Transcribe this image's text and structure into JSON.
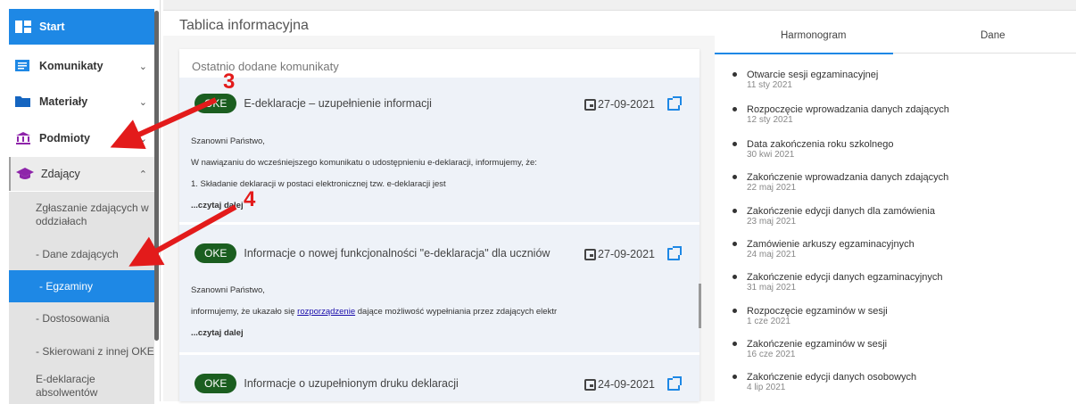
{
  "sidebar": {
    "start": "Start",
    "komunikaty": "Komunikaty",
    "materialy": "Materiały",
    "podmioty": "Podmioty",
    "zdajacy": "Zdający",
    "sub": {
      "zgl_1": "Zgłaszanie zdających w",
      "zgl_2": "oddziałach",
      "dane": "- Dane zdających",
      "egz": "- Egzaminy",
      "dost": "- Dostosowania",
      "skier": "- Skierowani z innej OKE",
      "edek_1": "E-deklaracje",
      "edek_2": "absolwentów"
    }
  },
  "header": {
    "title": "Tablica informacyjna"
  },
  "messages": {
    "section_title": "Ostatnio dodane komunikaty",
    "items": [
      {
        "badge": "OKE",
        "title": "E-deklaracje – uzupełnienie informacji",
        "date": "27-09-2021",
        "lines": [
          "Szanowni Państwo,",
          "W nawiązaniu do wcześniejszego komunikatu o udostępnieniu e-deklaracji, informujemy, że:",
          "1. Składanie deklaracji w postaci elektronicznej tzw. e-deklaracji jest"
        ],
        "more": "...czytaj dalej"
      },
      {
        "badge": "OKE",
        "title": "Informacje o nowej funkcjonalności \"e-deklaracja\" dla uczniów",
        "date": "27-09-2021",
        "line1": "Szanowni Państwo,",
        "line2_pre": "informujemy, że ukazało się ",
        "line2_link": "rozporządzenie",
        "line2_post": " dające możliwość wypełniania przez zdających elektr",
        "more": "...czytaj dalej"
      },
      {
        "badge": "OKE",
        "title": "Informacje o uzupełnionym druku deklaracji",
        "date": "24-09-2021"
      }
    ]
  },
  "right": {
    "tab_harmonogram": "Harmonogram",
    "tab_dane": "Dane",
    "events": [
      {
        "title": "Otwarcie sesji egzaminacyjnej",
        "date": "11 sty 2021"
      },
      {
        "title": "Rozpoczęcie wprowadzania danych zdających",
        "date": "12 sty 2021"
      },
      {
        "title": "Data zakończenia roku szkolnego",
        "date": "30 kwi 2021"
      },
      {
        "title": "Zakończenie wprowadzania danych zdających",
        "date": "22 maj 2021"
      },
      {
        "title": "Zakończenie edycji danych dla zamówienia",
        "date": "23 maj 2021"
      },
      {
        "title": "Zamówienie arkuszy egzaminacyjnych",
        "date": "24 maj 2021"
      },
      {
        "title": "Zakończenie edycji danych egzaminacyjnych",
        "date": "31 maj 2021"
      },
      {
        "title": "Rozpoczęcie egzaminów w sesji",
        "date": "1 cze 2021"
      },
      {
        "title": "Zakończenie egzaminów w sesji",
        "date": "16 cze 2021"
      },
      {
        "title": "Zakończenie edycji danych osobowych",
        "date": "4 lip 2021"
      }
    ]
  },
  "annotations": {
    "n3": "3",
    "n4": "4",
    "color": "#e31b1b"
  },
  "colors": {
    "accent": "#1e88e5",
    "badge": "#1b5e20"
  }
}
